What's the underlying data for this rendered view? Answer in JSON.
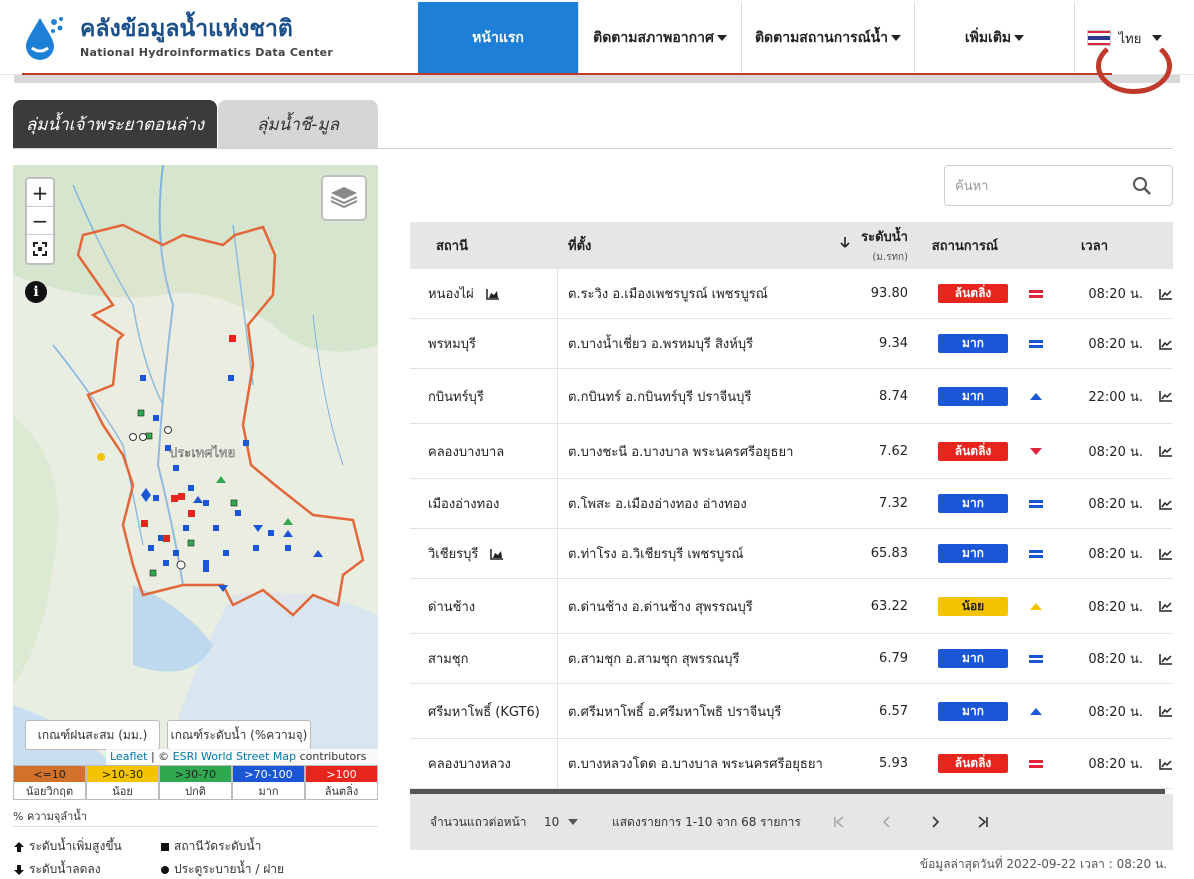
{
  "header": {
    "title_th": "คลังข้อมูลน้ำแห่งชาติ",
    "title_en": "National Hydroinformatics Data Center",
    "nav": [
      {
        "label": "หน้าแรก",
        "active": true
      },
      {
        "label": "ติดตามสภาพอากาศ",
        "dropdown": true
      },
      {
        "label": "ติดตามสถานการณ์น้ำ",
        "dropdown": true
      },
      {
        "label": "เพิ่มเติม",
        "dropdown": true
      }
    ],
    "language": "ไทย"
  },
  "tabs": [
    {
      "label": "ลุ่มน้ำเจ้าพระยาตอนล่าง",
      "active": true
    },
    {
      "label": "ลุ่มน้ำชี-มูล",
      "active": false
    }
  ],
  "map": {
    "zoom_in": "+",
    "zoom_out": "−",
    "info": "i",
    "place_label": "ประเทศไทย",
    "rain_button": "เกณฑ์ฝนสะสม (มม.)",
    "water_button": "เกณฑ์ระดับน้ำ (%ความจุ)",
    "attribution": {
      "leaflet": "Leaflet",
      "sep": " | © ",
      "esri": "ESRI World Street Map",
      "tail": " contributors"
    }
  },
  "legend": {
    "scale": [
      {
        "range": "<=10",
        "label": "น้อยวิกฤต",
        "color": "#d2722a",
        "text_color": "#222"
      },
      {
        "range": ">10-30",
        "label": "น้อย",
        "color": "#f5c400",
        "text_color": "#222"
      },
      {
        "range": ">30-70",
        "label": "ปกติ",
        "color": "#2fa84f",
        "text_color": "#222"
      },
      {
        "range": ">70-100",
        "label": "มาก",
        "color": "#1a56d6",
        "text_color": "#fff"
      },
      {
        "range": ">100",
        "label": "ล้นตลิ่ง",
        "color": "#e8251d",
        "text_color": "#fff"
      }
    ],
    "note": "% ความจุลำน้ำ",
    "rise": "ระดับน้ำเพิ่มสูงขึ้น",
    "fall": "ระดับน้ำลดลง",
    "station": "สถานีวัดระดับน้ำ",
    "gate": "ประตูระบายน้ำ / ฝาย"
  },
  "search": {
    "placeholder": "ค้นหา"
  },
  "table": {
    "headers": {
      "station": "สถานี",
      "location": "ที่ตั้ง",
      "level": "ระดับน้ำ",
      "level_unit": "(ม.รทก)",
      "status": "สถานการณ์",
      "time": "เวลา"
    },
    "rows": [
      {
        "station": "หนองไผ่",
        "has_icon": true,
        "location": "ต.ระวิง อ.เมืองเพชรบูรณ์ เพชรบูรณ์",
        "level": "93.80",
        "status": "ล้นตลิ่ง",
        "status_color": "#e8251d",
        "trend": "equal",
        "trend_color": "#e0243a",
        "time": "08:20 น."
      },
      {
        "station": "พรหมบุรี",
        "has_icon": false,
        "location": "ต.บางน้ำเชี่ยว อ.พรหมบุรี สิงห์บุรี",
        "level": "9.34",
        "status": "มาก",
        "status_color": "#1a56d6",
        "trend": "equal",
        "trend_color": "#1a56d6",
        "time": "08:20 น."
      },
      {
        "station": "กบินทร์บุรี",
        "has_icon": false,
        "location": "ต.กบินทร์ อ.กบินทร์บุรี ปราจีนบุรี",
        "level": "8.74",
        "status": "มาก",
        "status_color": "#1a56d6",
        "trend": "up",
        "trend_color": "#1a56d6",
        "time": "22:00 น."
      },
      {
        "station": "คลองบางบาล",
        "has_icon": false,
        "location": "ต.บางชะนี อ.บางบาล พระนครศรีอยุธยา",
        "level": "7.62",
        "status": "ล้นตลิ่ง",
        "status_color": "#e8251d",
        "trend": "down",
        "trend_color": "#e0243a",
        "time": "08:20 น."
      },
      {
        "station": "เมืองอ่างทอง",
        "has_icon": false,
        "location": "ต.โพสะ อ.เมืองอ่างทอง อ่างทอง",
        "level": "7.32",
        "status": "มาก",
        "status_color": "#1a56d6",
        "trend": "equal",
        "trend_color": "#1a56d6",
        "time": "08:20 น."
      },
      {
        "station": "วิเชียรบุรี",
        "has_icon": true,
        "location": "ต.ท่าโรง อ.วิเชียรบุรี เพชรบูรณ์",
        "level": "65.83",
        "status": "มาก",
        "status_color": "#1a56d6",
        "trend": "equal",
        "trend_color": "#1a56d6",
        "time": "08:20 น."
      },
      {
        "station": "ด่านช้าง",
        "has_icon": false,
        "location": "ต.ด่านช้าง อ.ด่านช้าง สุพรรณบุรี",
        "level": "63.22",
        "status": "น้อย",
        "status_color": "#f5c400",
        "trend": "up",
        "trend_color": "#f5c400",
        "time": "08:20 น."
      },
      {
        "station": "สามชุก",
        "has_icon": false,
        "location": "ต.สามชุก อ.สามชุก สุพรรณบุรี",
        "level": "6.79",
        "status": "มาก",
        "status_color": "#1a56d6",
        "trend": "equal",
        "trend_color": "#1a56d6",
        "time": "08:20 น."
      },
      {
        "station": "ศรีมหาโพธิ์ (KGT6)",
        "has_icon": false,
        "location": "ต.ศรีมหาโพธิ์ อ.ศรีมหาโพธิ ปราจีนบุรี",
        "level": "6.57",
        "status": "มาก",
        "status_color": "#1a56d6",
        "trend": "up",
        "trend_color": "#1a56d6",
        "time": "08:20 น."
      },
      {
        "station": "คลองบางหลวง",
        "has_icon": false,
        "location": "ต.บางหลวงโดด อ.บางบาล พระนครศรีอยุธยา",
        "level": "5.93",
        "status": "ล้นตลิ่ง",
        "status_color": "#e8251d",
        "trend": "equal",
        "trend_color": "#e0243a",
        "time": "08:20 น."
      }
    ]
  },
  "pagination": {
    "rows_per_page_label": "จำนวนแถวต่อหน้า",
    "rows_per_page": "10",
    "range_text": "แสดงรายการ 1-10 จาก 68 รายการ"
  },
  "footer": {
    "updated": "ข้อมูลล่าสุดวันที่ 2022-09-22 เวลา : 08:20 น."
  }
}
